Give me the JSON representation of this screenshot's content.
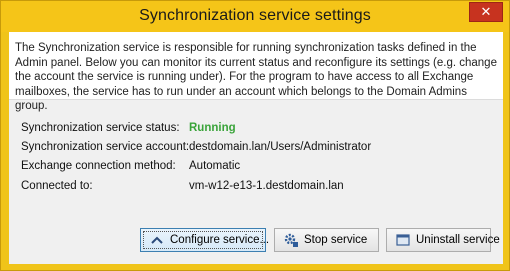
{
  "window": {
    "title": "Synchronization service settings",
    "close_label": "✕"
  },
  "info": {
    "text": "The Synchronization service is responsible for running synchronization tasks defined in the Admin panel. Below you can monitor its current status and reconfigure its settings (e.g. change the account the service is running under). For the program to have access to all Exchange mailboxes, the service has to run under an account which belongs to the Domain Admins group."
  },
  "details": {
    "status_label": "Synchronization service status:",
    "status_value": "Running",
    "account_label": "Synchronization service account:",
    "account_value": "destdomain.lan/Users/Administrator",
    "method_label": "Exchange connection method:",
    "method_value": "Automatic",
    "connected_label": "Connected to:",
    "connected_value": "vm-w12-e13-1.destdomain.lan"
  },
  "buttons": {
    "configure": "Configure service...",
    "stop": "Stop service",
    "uninstall": "Uninstall service"
  },
  "colors": {
    "titlebar": "#f5c518",
    "running": "#3aa43a",
    "close": "#c7331f"
  }
}
